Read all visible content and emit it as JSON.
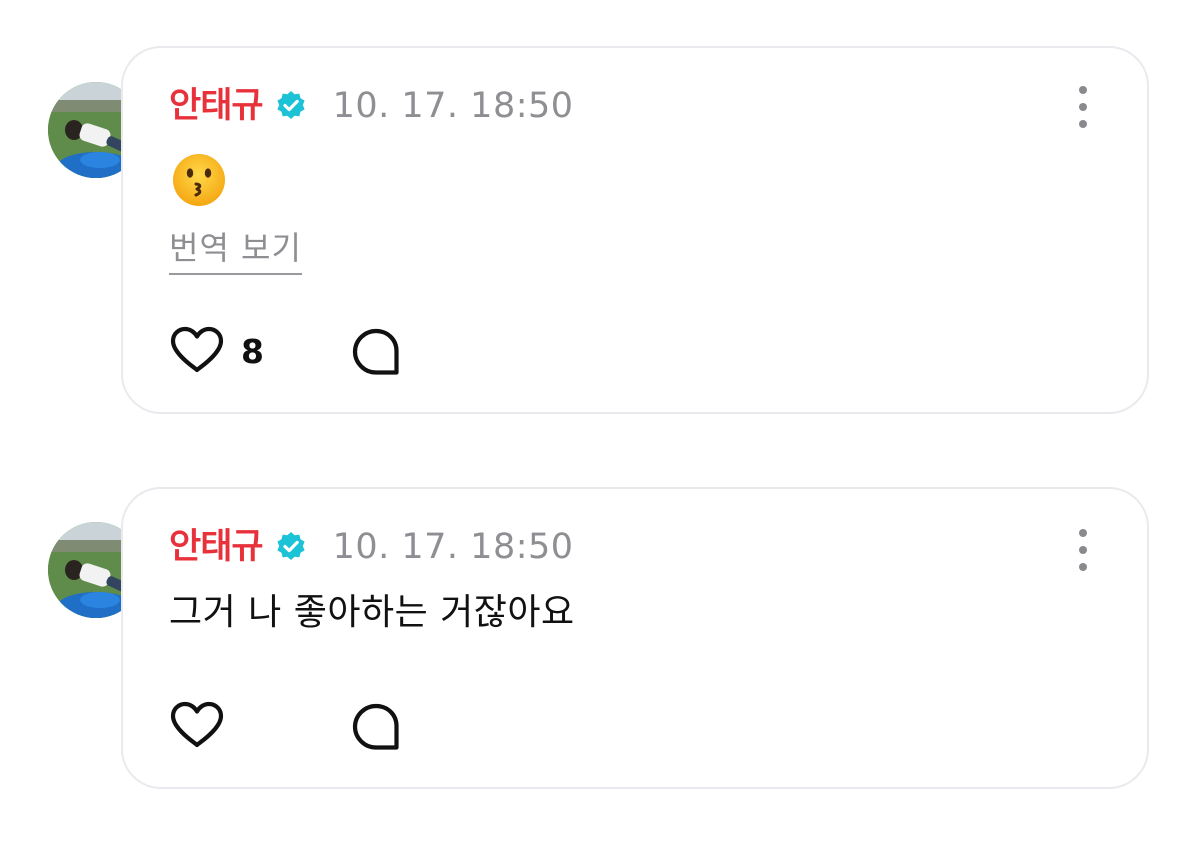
{
  "posts": [
    {
      "username": "안태규",
      "timestamp": "10. 17. 18:50",
      "emoji": "kissing-face",
      "translate_label": "번역 보기",
      "like_count": "8",
      "icons": {
        "verified": "verified-badge-icon",
        "more": "more-vertical-icon",
        "like": "heart-icon",
        "reply": "speech-bubble-icon"
      }
    },
    {
      "username": "안태규",
      "timestamp": "10. 17. 18:50",
      "text": "그거 나 좋아하는 거잖아요",
      "icons": {
        "verified": "verified-badge-icon",
        "more": "more-vertical-icon",
        "like": "heart-icon",
        "reply": "speech-bubble-icon"
      }
    }
  ],
  "colors": {
    "username": "#e8323b",
    "verified": "#1cc2d6",
    "timestamp": "#8e8e93",
    "card_border": "#e9e9ee"
  }
}
